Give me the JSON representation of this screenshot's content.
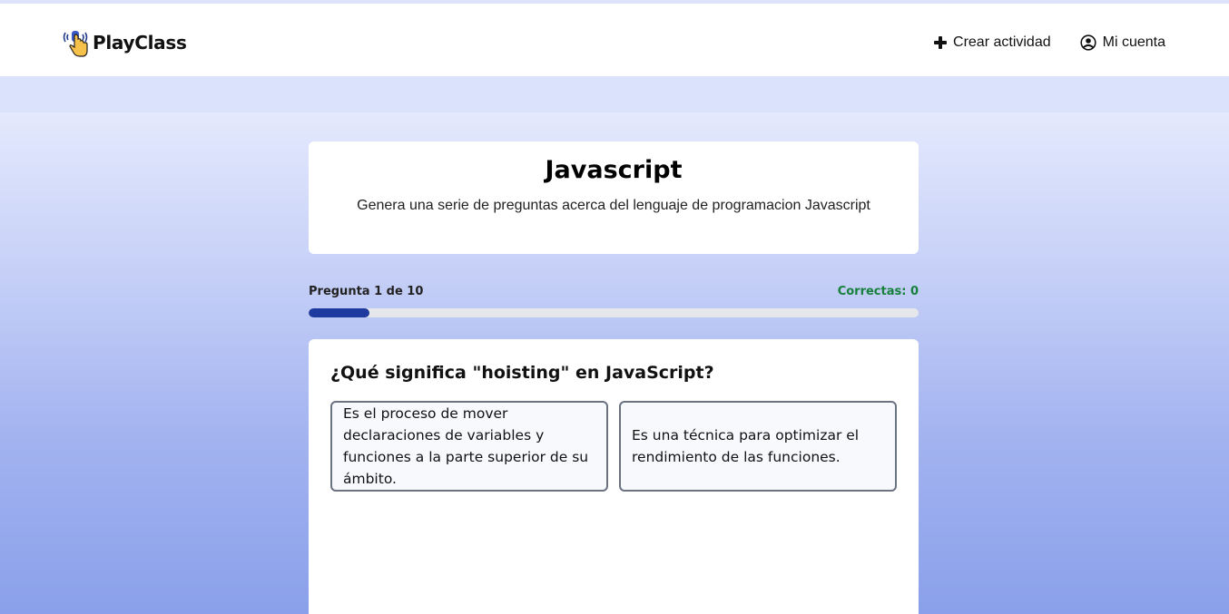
{
  "brand": {
    "name": "PlayClass",
    "logo_icon": "hand-pointer-broadcast-icon"
  },
  "nav": {
    "create_activity": "Crear actividad",
    "create_icon": "plus-icon",
    "my_account": "Mi cuenta",
    "account_icon": "user-circle-icon"
  },
  "activity": {
    "title": "Javascript",
    "description": "Genera una serie de preguntas acerca del lenguaje de programacion Javascript"
  },
  "progress": {
    "question_label": "Pregunta 1 de 10",
    "correct_label": "Correctas: 0",
    "fraction": 0.1
  },
  "question": {
    "text": "¿Qué significa \"hoisting\" en JavaScript?",
    "options": [
      "Es el proceso de mover declaraciones de variables y funciones a la parte superior de su ámbito.",
      "Es una técnica para optimizar el rendimiento de las funciones."
    ]
  },
  "colors": {
    "progress_fill": "#1e3a9e",
    "correct_text": "#16803c",
    "background_top": "#e4e9fd",
    "background_bottom": "#8aa0ea"
  }
}
